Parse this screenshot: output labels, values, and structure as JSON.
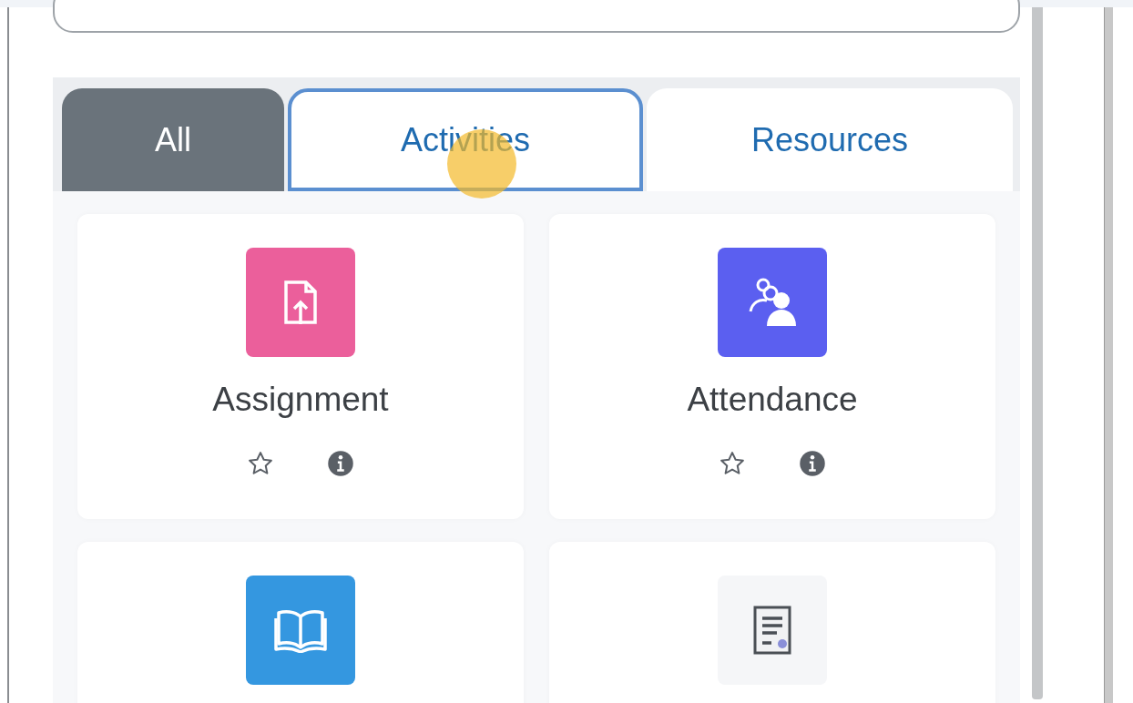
{
  "tabs": [
    {
      "label": "All",
      "selected": true,
      "focused": false,
      "hovered": false
    },
    {
      "label": "Activities",
      "selected": false,
      "focused": true,
      "hovered": true
    },
    {
      "label": "Resources",
      "selected": false,
      "focused": false,
      "hovered": false
    }
  ],
  "modules": [
    {
      "name": "Assignment",
      "kind": "assignment",
      "color": "#eb5f9b",
      "starred": false
    },
    {
      "name": "Attendance",
      "kind": "attendance",
      "color": "#5b5ff0",
      "starred": false
    },
    {
      "kind": "book",
      "color": "#3497e0"
    },
    {
      "kind": "page",
      "color": "#f5f6f8"
    }
  ]
}
